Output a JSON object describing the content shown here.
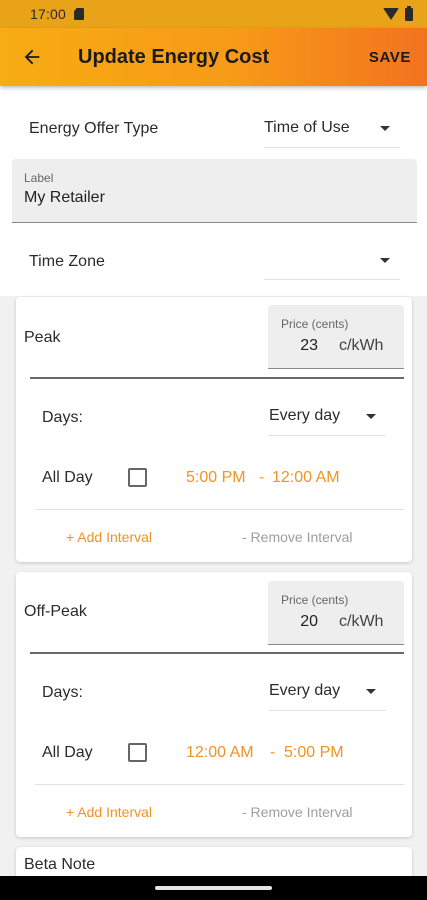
{
  "status_bar": {
    "time": "17:00",
    "sd_icon": "sd-card-icon",
    "wifi_icon": "wifi-icon",
    "battery_icon": "battery-icon"
  },
  "app_bar": {
    "title": "Update Energy Cost",
    "back_icon": "arrow-back-icon",
    "save_label": "SAVE",
    "gradient": [
      "#f7ac13",
      "#f2731f"
    ]
  },
  "form": {
    "offer_type": {
      "label": "Energy Offer Type",
      "value": "Time of Use"
    },
    "label_field": {
      "label": "Label",
      "value": "My Retailer"
    },
    "time_zone": {
      "label": "Time Zone",
      "value": ""
    }
  },
  "tariffs": [
    {
      "name": "Peak",
      "price_label": "Price (cents)",
      "price_value": "23",
      "price_unit": "c/kWh",
      "days_label": "Days:",
      "days_value": "Every day",
      "all_day_label": "All Day",
      "all_day_checked": false,
      "start_time": "5:00 PM",
      "separator": "-",
      "end_time": "12:00 AM",
      "add_interval": "+ Add Interval",
      "remove_interval": "- Remove Interval"
    },
    {
      "name": "Off-Peak",
      "price_label": "Price (cents)",
      "price_value": "20",
      "price_unit": "c/kWh",
      "days_label": "Days:",
      "days_value": "Every day",
      "all_day_label": "All Day",
      "all_day_checked": false,
      "start_time": "12:00 AM",
      "separator": "-",
      "end_time": "5:00 PM",
      "add_interval": "+ Add Interval",
      "remove_interval": "- Remove Interval"
    }
  ],
  "beta_note": {
    "title": "Beta Note"
  },
  "colors": {
    "accent": "#f19322",
    "status_bar": "#e8a318"
  }
}
